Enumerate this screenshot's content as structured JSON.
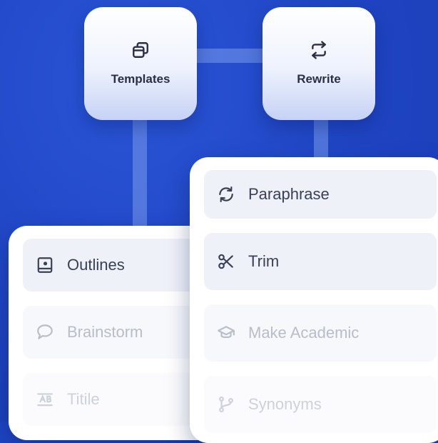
{
  "tiles": [
    {
      "label": "Templates",
      "icon": "stacked-windows-icon"
    },
    {
      "label": "Rewrite",
      "icon": "swap-arrows-icon"
    }
  ],
  "left_menu": {
    "items": [
      {
        "label": "Outlines",
        "icon": "book-icon",
        "state": "active"
      },
      {
        "label": "Brainstorm",
        "icon": "speech-bubble-icon",
        "state": "muted"
      },
      {
        "label": "Titile",
        "icon": "title-text-icon",
        "state": "faded"
      }
    ]
  },
  "right_menu": {
    "items": [
      {
        "label": "Paraphrase",
        "icon": "refresh-icon",
        "state": "active"
      },
      {
        "label": "Trim",
        "icon": "scissors-icon",
        "state": "active"
      },
      {
        "label": "Make Academic",
        "icon": "graduation-cap-icon",
        "state": "muted"
      },
      {
        "label": "Synonyms",
        "icon": "branch-icon",
        "state": "faded"
      }
    ]
  },
  "colors": {
    "background": "#1f44c2",
    "tile_gradient_bottom": "#c6d2f6",
    "active_item_bg": "#eef1f8",
    "text_dark": "#2a2f45"
  }
}
